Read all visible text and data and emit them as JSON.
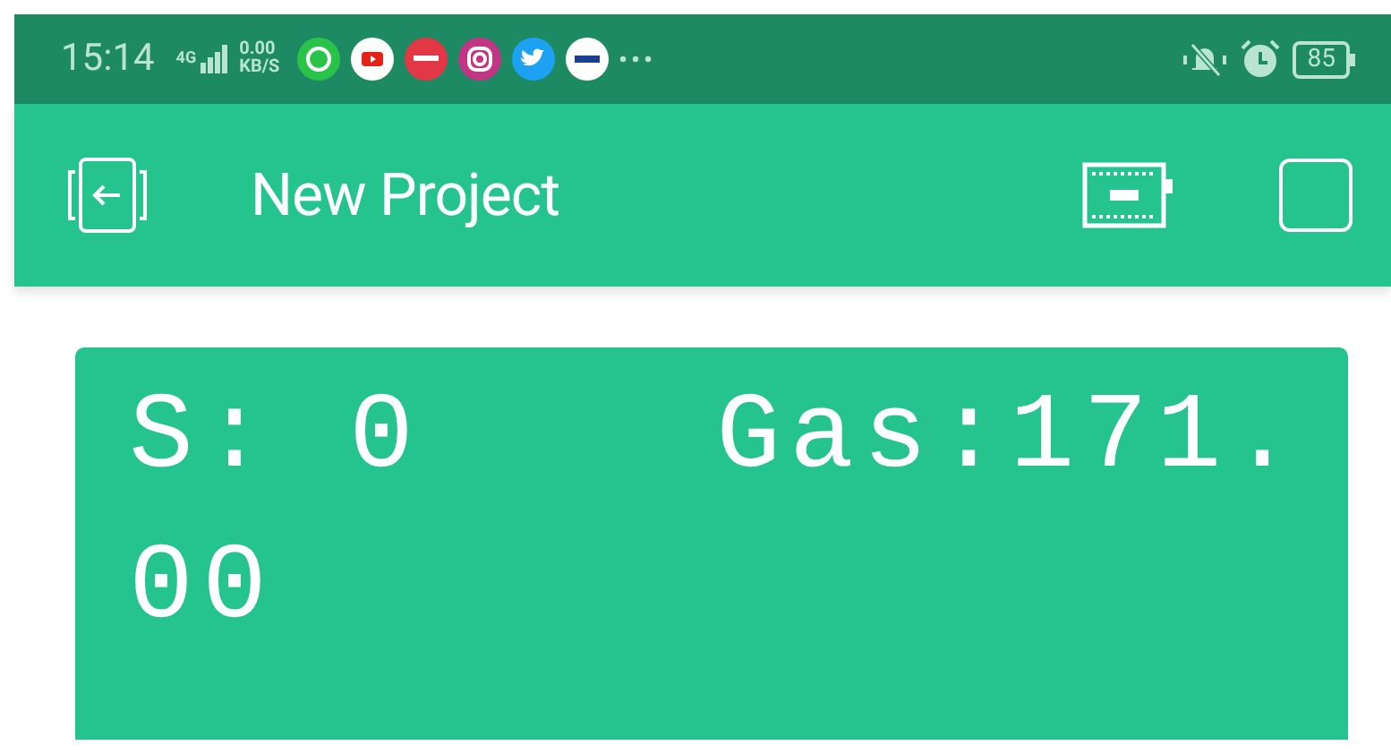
{
  "status_bar": {
    "time": "15:14",
    "network_type": "4G",
    "data_rate": "0.00",
    "data_unit": "KB/S",
    "battery": "85"
  },
  "header": {
    "title": "New Project"
  },
  "lcd": {
    "lines": [
      "S: 0    Gas:171.",
      "00"
    ]
  }
}
